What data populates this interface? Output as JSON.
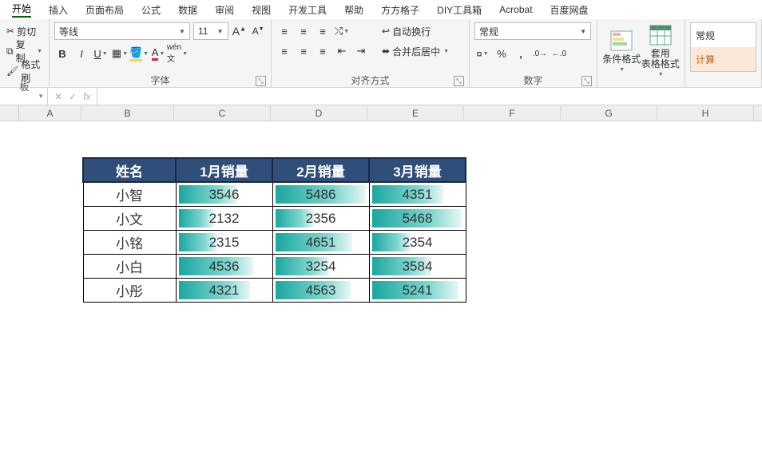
{
  "menubar": {
    "tabs": [
      "开始",
      "插入",
      "页面布局",
      "公式",
      "数据",
      "审阅",
      "视图",
      "开发工具",
      "帮助",
      "方方格子",
      "DIY工具箱",
      "Acrobat",
      "百度网盘"
    ],
    "active": 0
  },
  "ribbon": {
    "clipboard": {
      "cut": "剪切",
      "copy": "复制",
      "paint": "格式刷",
      "label": "板"
    },
    "font": {
      "name": "等线",
      "size": "11",
      "label": "字体",
      "bold": "B",
      "italic": "I",
      "underline": "U"
    },
    "align": {
      "wrap": "自动换行",
      "merge": "合并后居中",
      "label": "对齐方式"
    },
    "number": {
      "fmt": "常规",
      "label": "数字"
    },
    "styles": {
      "condfmt": "条件格式",
      "tablefmt": "套用\n表格格式"
    },
    "stylePreview": {
      "normal": "常规",
      "calc": "计算"
    }
  },
  "fbar": {
    "name": "",
    "fx": "fx"
  },
  "columns": [
    "A",
    "B",
    "C",
    "D",
    "E",
    "F",
    "G",
    "H"
  ],
  "table": {
    "headers": [
      "姓名",
      "1月销量",
      "2月销量",
      "3月销量"
    ],
    "rows": [
      {
        "name": "小智",
        "vals": [
          3546,
          5486,
          4351
        ]
      },
      {
        "name": "小文",
        "vals": [
          2132,
          2356,
          5468
        ]
      },
      {
        "name": "小铭",
        "vals": [
          2315,
          4651,
          2354
        ]
      },
      {
        "name": "小白",
        "vals": [
          4536,
          3254,
          3584
        ]
      },
      {
        "name": "小彤",
        "vals": [
          4321,
          4563,
          5241
        ]
      }
    ],
    "max": 5500
  },
  "chart_data": {
    "type": "table",
    "title": "",
    "columns": [
      "姓名",
      "1月销量",
      "2月销量",
      "3月销量"
    ],
    "rows": [
      [
        "小智",
        3546,
        5486,
        4351
      ],
      [
        "小文",
        2132,
        2356,
        5468
      ],
      [
        "小铭",
        2315,
        4651,
        2354
      ],
      [
        "小白",
        4536,
        3254,
        3584
      ],
      [
        "小彤",
        4321,
        4563,
        5241
      ]
    ]
  }
}
